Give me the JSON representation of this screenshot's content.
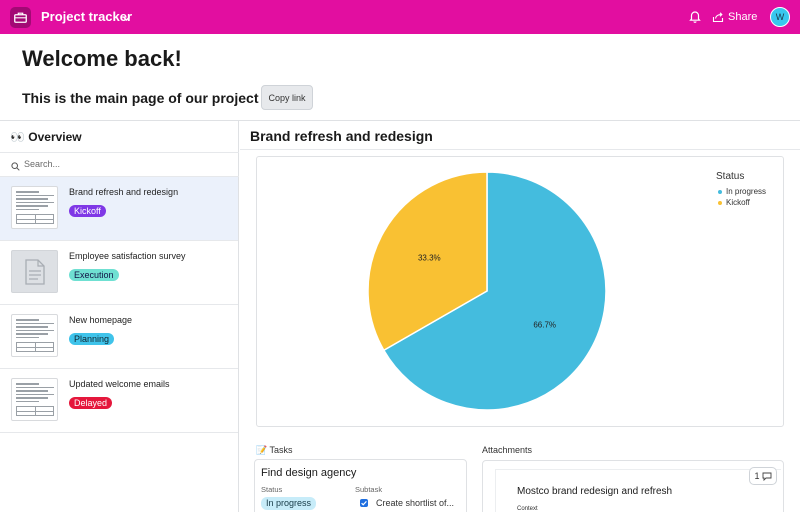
{
  "header": {
    "app_title": "Project tracker",
    "share_label": "Share",
    "avatar_initial": "W",
    "bg_color": "#e20ea0",
    "icons": [
      "briefcase-icon",
      "chevron-down-icon",
      "bell-icon",
      "share-icon"
    ]
  },
  "welcome": {
    "title": "Welcome back!",
    "subtitle": "This is the main page of our project",
    "copy_link_label": "Copy link"
  },
  "sidebar": {
    "title": "👀 Overview",
    "search_placeholder": "Search...",
    "items": [
      {
        "name": "Brand refresh and redesign",
        "status": "Kickoff",
        "status_color": "#7f38e6",
        "selected": true,
        "thumbnail": "document"
      },
      {
        "name": "Employee satisfaction survey",
        "status": "Execution",
        "status_color": "#6fe0d2",
        "selected": false,
        "thumbnail": "placeholder"
      },
      {
        "name": "New homepage",
        "status": "Planning",
        "status_color": "#3fc3ea",
        "selected": false,
        "thumbnail": "document"
      },
      {
        "name": "Updated welcome emails",
        "status": "Delayed",
        "status_color": "#e5173c",
        "selected": false,
        "thumbnail": "document"
      }
    ]
  },
  "main": {
    "title": "Brand refresh and redesign",
    "tasks_label": "📝 Tasks",
    "task": {
      "title": "Find design agency",
      "status_header": "Status",
      "subtask_header": "Subtask",
      "status": "In progress",
      "subtask": "Create shortlist of...",
      "subtask_checked": true
    },
    "attachments_label": "Attachments",
    "attachment": {
      "title": "Mostco brand redesign and refresh",
      "subtitle": "Context",
      "comment_count": "1"
    }
  },
  "chart_data": {
    "type": "pie",
    "legend_title": "Status",
    "legend_position": "top-right",
    "slices": [
      {
        "label": "In progress",
        "value": 66.7,
        "display": "66.7%",
        "color": "#44bcde"
      },
      {
        "label": "Kickoff",
        "value": 33.3,
        "display": "33.3%",
        "color": "#f9c133"
      }
    ]
  }
}
